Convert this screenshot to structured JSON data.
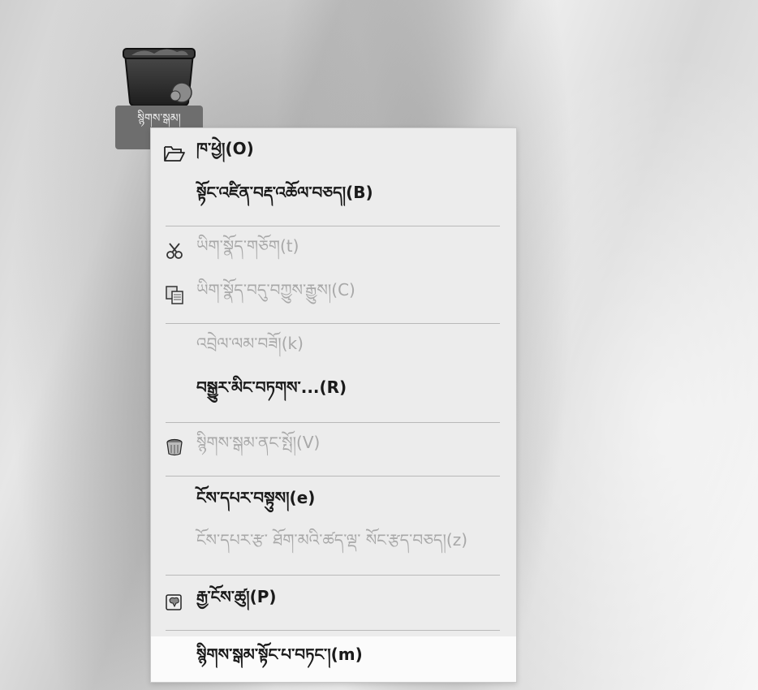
{
  "desktop_icon": {
    "label": "སྙིགས་སྒམ།",
    "icon": "trash-icon"
  },
  "menu": {
    "items": [
      {
        "label": "ཁ་ཕྱེ།(O)",
        "icon": "folder-open-icon",
        "enabled": true
      },
      {
        "label": "སྟོང་འཛིན་བརྡ་འཆོལ་བཅད།(B)",
        "icon": "",
        "enabled": true
      },
      {
        "label": "ཡིག་སྣོད་གཅོག(t)",
        "icon": "scissors-icon",
        "enabled": false
      },
      {
        "label": "ཡིག་སྣོད་བདུ་བཀྱུས་རྒྱུས།(C)",
        "icon": "copy-icon",
        "enabled": false
      },
      {
        "label": "འབྲེལ་ལམ་བཟོ།(k)",
        "icon": "",
        "enabled": false
      },
      {
        "label": "བསྒྱུར་མིང་བཏགས་...(R)",
        "icon": "",
        "enabled": true
      },
      {
        "label": "སྙིགས་སྒམ་ནང་སྤོ།(V)",
        "icon": "trash-small-icon",
        "enabled": false
      },
      {
        "label": "ངོས་དཔར་བསྟུས།(e)",
        "icon": "",
        "enabled": true
      },
      {
        "label": "ངོས་དཔར་རྩ་ ཐོག་མའི་ཚད་ལྡ་ སོང་རྩད་བཅད།(z)",
        "icon": "",
        "enabled": false
      },
      {
        "label": "རྒྱ་ངོས་ཚུ།(P)",
        "icon": "properties-icon",
        "enabled": true
      },
      {
        "label": "སྙིགས་སྒམ་སྟོང་པ་བཏང་།(m)",
        "icon": "",
        "enabled": true
      }
    ]
  }
}
